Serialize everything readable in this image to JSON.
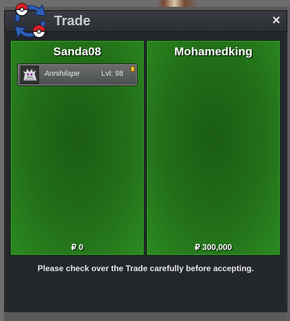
{
  "window": {
    "title": "Trade",
    "close_label": "×"
  },
  "left_panel": {
    "player_name": "Sanda08",
    "items": [
      {
        "name": "Annihilape",
        "level": "Lvl: 98",
        "icon": "annihilape-sprite"
      }
    ],
    "money": "₽ 0"
  },
  "right_panel": {
    "player_name": "Mohamedking",
    "items": [],
    "money": "₽ 300,000"
  },
  "notice": "Please check over the Trade carefully before accepting.",
  "colors": {
    "panel_green": "#226f18",
    "window_bg": "#23262b",
    "pokeball_red": "#d42027",
    "logo_blue": "#2e5fb5"
  }
}
